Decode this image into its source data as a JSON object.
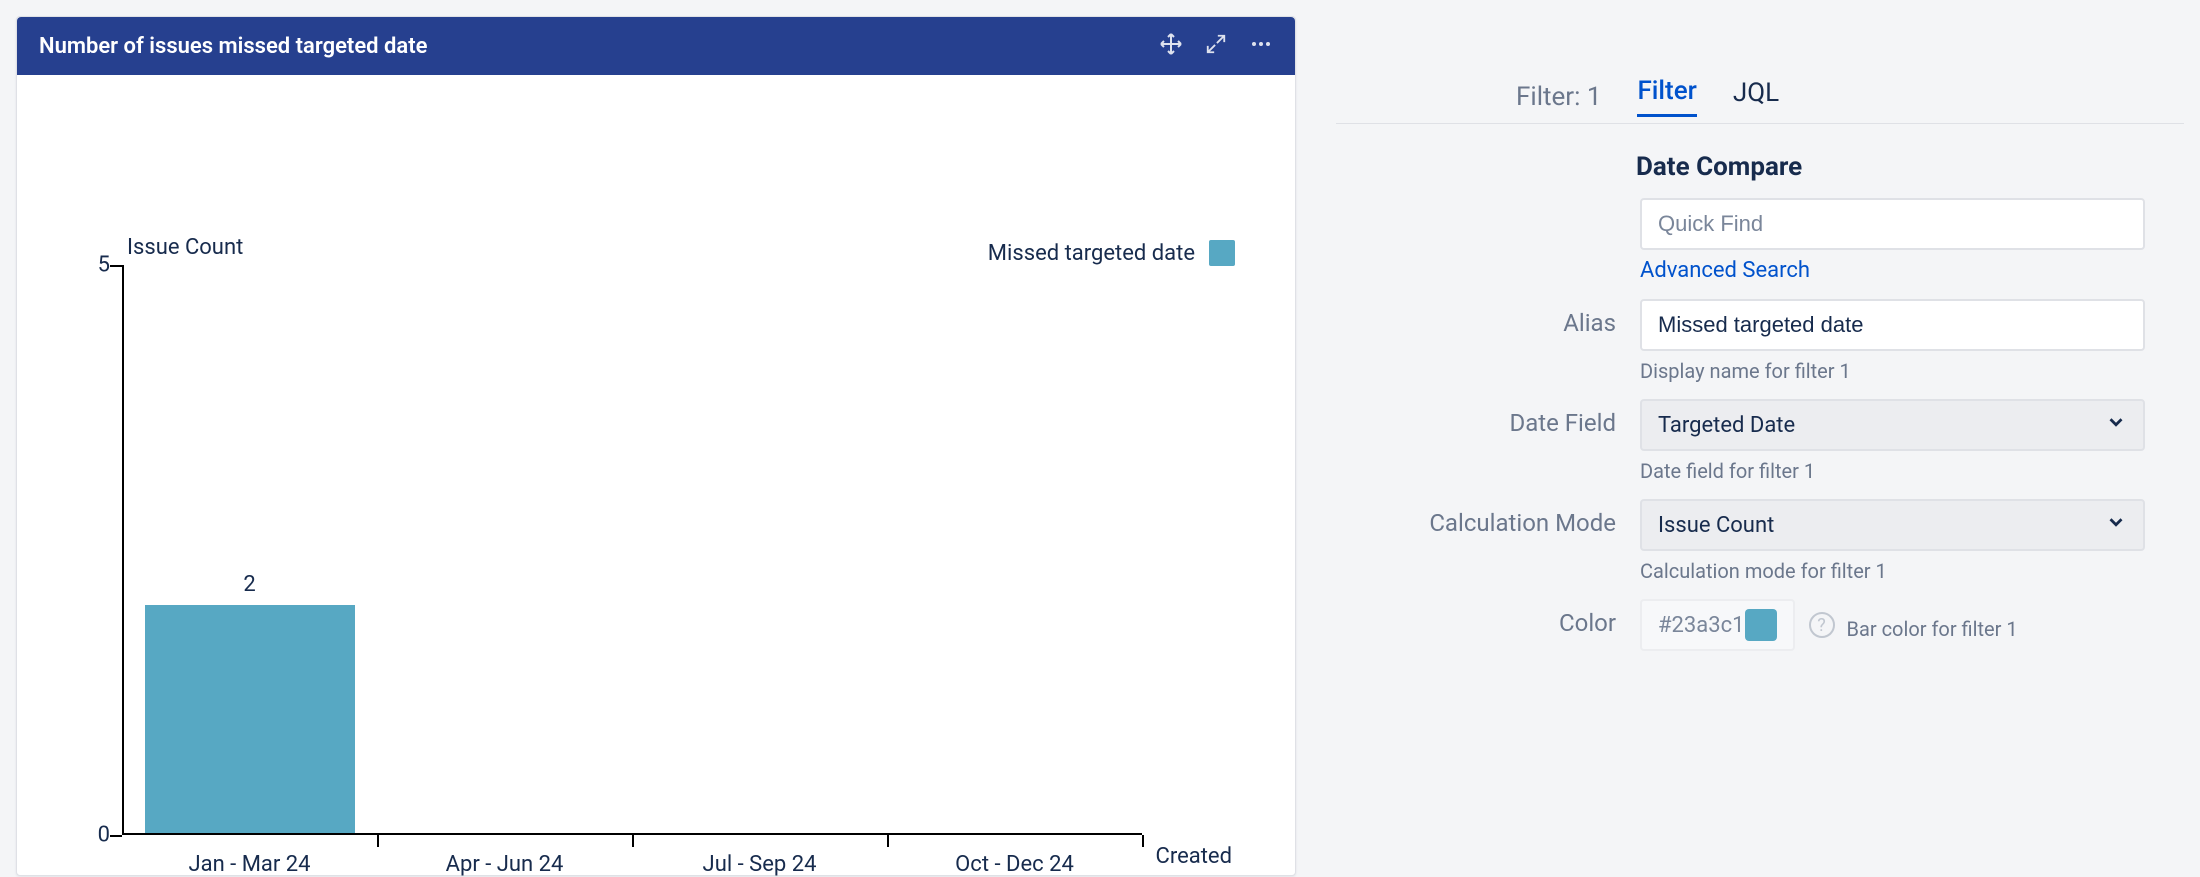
{
  "panel": {
    "title": "Number of issues missed targeted date"
  },
  "legend": {
    "label": "Missed targeted date"
  },
  "chart_data": {
    "type": "bar",
    "ylabel": "Issue Count",
    "xlabel": "Created",
    "categories": [
      "Jan - Mar 24",
      "Apr - Jun 24",
      "Jul - Sep 24",
      "Oct - Dec 24"
    ],
    "values": [
      2,
      0,
      0,
      0
    ],
    "ylim": [
      0,
      5
    ],
    "yticks": [
      0,
      5
    ],
    "series_name": "Missed targeted date",
    "series_color": "#57a8c3"
  },
  "config": {
    "filter_count_label": "Filter: 1",
    "tabs": {
      "filter": "Filter",
      "jql": "JQL"
    },
    "section_title": "Date Compare",
    "quickfind_placeholder": "Quick Find",
    "advanced_link": "Advanced Search",
    "alias": {
      "label": "Alias",
      "value": "Missed targeted date",
      "hint": "Display name for filter 1"
    },
    "date_field": {
      "label": "Date Field",
      "value": "Targeted Date",
      "hint": "Date field for filter 1"
    },
    "calc_mode": {
      "label": "Calculation Mode",
      "value": "Issue Count",
      "hint": "Calculation mode for filter 1"
    },
    "color": {
      "label": "Color",
      "value": "#23a3c1",
      "hint": "Bar color for filter 1"
    }
  }
}
